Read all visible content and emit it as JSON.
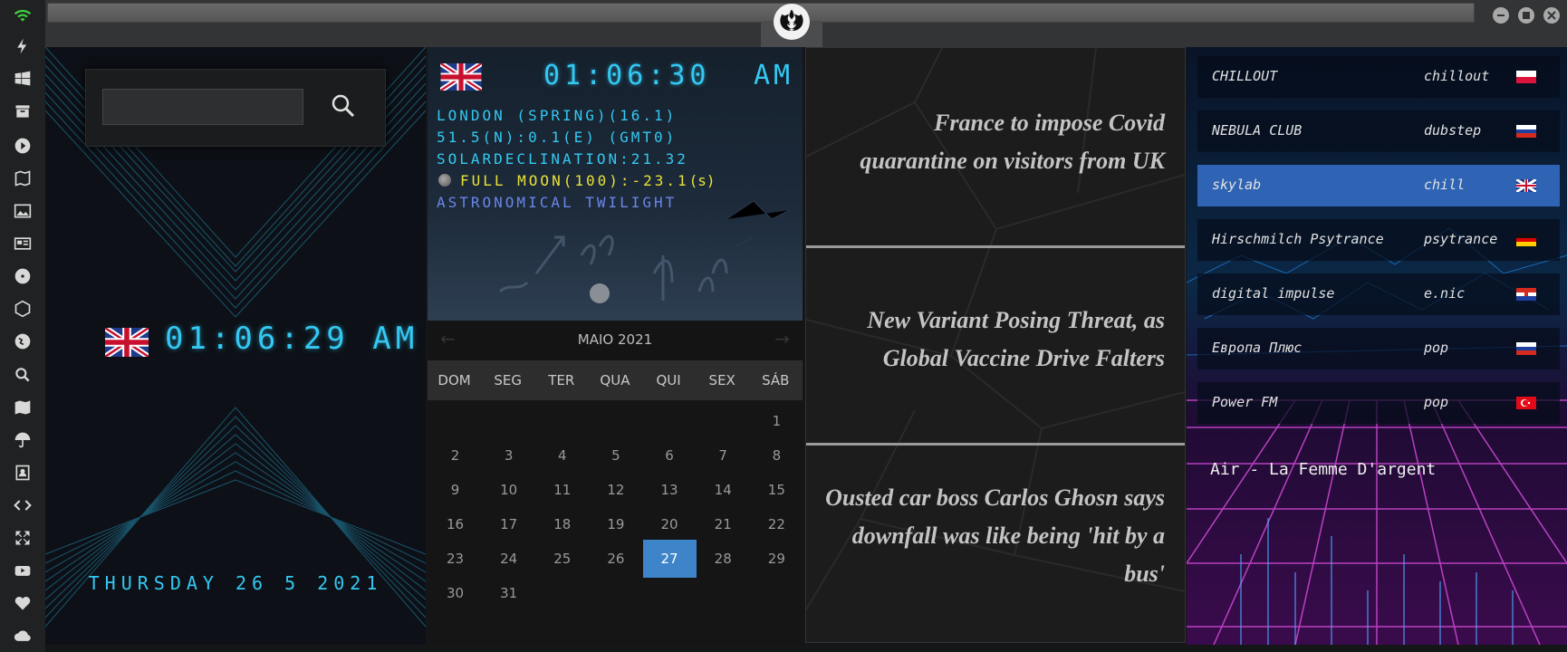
{
  "rail_icons": [
    "wifi-icon",
    "bolt-icon",
    "windows-icon",
    "archive-icon",
    "play-icon",
    "map-book-icon",
    "image-icon",
    "newspaper-icon",
    "radioactive-icon",
    "hexagon-icon",
    "globe-icon",
    "search-icon",
    "map-icon",
    "umbrella-icon",
    "contacts-icon",
    "code-icon",
    "expand-icon",
    "youtube-icon",
    "heart-icon",
    "cloud-icon"
  ],
  "colors": {
    "accent": "#34c8f2",
    "moon_text": "#e8e23a",
    "twilight_text": "#6a86e8",
    "selected_day": "#3d84c9",
    "radio_active": "#2f64b4"
  },
  "clock_panel": {
    "time": "01:06:29 AM",
    "date": "THURSDAY 26 5 2021"
  },
  "astro_panel": {
    "time": "01:06:30",
    "ampm": "AM",
    "location": "LONDON (SPRING)(16.1)",
    "coords": "51.5(N):0.1(E) (GMT0)",
    "declination": "SOLARDECLINATION:21.32",
    "moon": "FULL MOON(100):-23.1",
    "moon_unit": "(s)",
    "twilight": "ASTRONOMICAL TWILIGHT"
  },
  "calendar": {
    "title": "MAIO 2021",
    "prev": "←",
    "next": "→",
    "weekdays": [
      "DOM",
      "SEG",
      "TER",
      "QUA",
      "QUI",
      "SEX",
      "SÁB"
    ],
    "first_weekday": 6,
    "days": [
      "1",
      "2",
      "3",
      "4",
      "5",
      "6",
      "7",
      "8",
      "9",
      "10",
      "11",
      "12",
      "13",
      "14",
      "15",
      "16",
      "17",
      "18",
      "19",
      "20",
      "21",
      "22",
      "23",
      "24",
      "25",
      "26",
      "27",
      "28",
      "29",
      "30",
      "31"
    ],
    "selected": "27"
  },
  "news": [
    "France to impose Covid quarantine on visitors from UK",
    "New Variant Posing Threat, as Global Vaccine Drive Falters",
    "Ousted car boss Carlos Ghosn says downfall was like being 'hit by a bus'"
  ],
  "radio": {
    "stations": [
      {
        "name": "CHILLOUT",
        "genre": "chillout",
        "flag": "poland"
      },
      {
        "name": "NEBULA CLUB",
        "genre": "dubstep",
        "flag": "russia"
      },
      {
        "name": "skylab",
        "genre": "chill",
        "flag": "uk"
      },
      {
        "name": "Hirschmilch Psytrance",
        "genre": "psytrance",
        "flag": "germany"
      },
      {
        "name": "digital impulse",
        "genre": "e.nic",
        "flag": "croatia"
      },
      {
        "name": "Европа Плюс",
        "genre": "pop",
        "flag": "russia"
      },
      {
        "name": "Power FM",
        "genre": "pop",
        "flag": "turkey"
      }
    ],
    "active_index": 2,
    "now_playing": "Air - La Femme D'argent"
  }
}
